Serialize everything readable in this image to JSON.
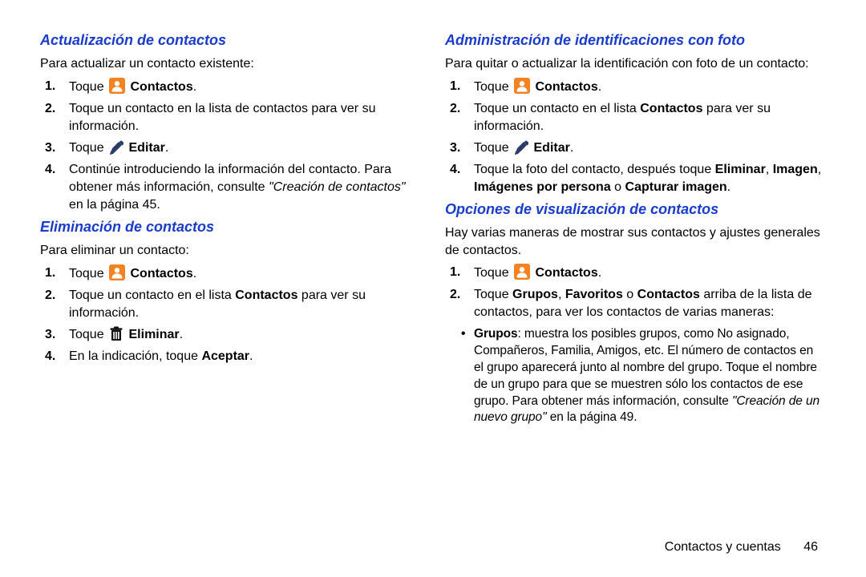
{
  "left": {
    "sec1": {
      "title": "Actualización de contactos",
      "intro": "Para actualizar un contacto existente:",
      "items": [
        {
          "pre": "Toque ",
          "icon": "contacts",
          "post": " ",
          "bold": "Contactos",
          "tail": "."
        },
        {
          "text": "Toque un contacto en la lista de contactos para ver su información."
        },
        {
          "pre": "Toque ",
          "icon": "pencil",
          "post": "  ",
          "bold": "Editar",
          "tail": "."
        },
        {
          "pre": "Continúe introduciendo la información del contacto. Para obtener más información, consulte ",
          "ital": "\"Creación de contactos\"",
          "tail": "  en la página 45."
        }
      ]
    },
    "sec2": {
      "title": "Eliminación de contactos",
      "intro": "Para eliminar un contacto:",
      "items": [
        {
          "pre": "Toque ",
          "icon": "contacts",
          "post": " ",
          "bold": "Contactos",
          "tail": "."
        },
        {
          "pre": "Toque un contacto en el lista ",
          "bold": "Contactos",
          "tail": " para ver su información."
        },
        {
          "pre": "Toque  ",
          "icon": "trash",
          "post": "  ",
          "bold": "Eliminar",
          "tail": "."
        },
        {
          "pre": "En la indicación, toque ",
          "bold": "Aceptar",
          "tail": "."
        }
      ]
    }
  },
  "right": {
    "sec1": {
      "title": "Administración de identificaciones con foto",
      "intro": "Para quitar o actualizar la identificación con foto de un contacto:",
      "items": [
        {
          "pre": "Toque ",
          "icon": "contacts",
          "post": " ",
          "bold": "Contactos",
          "tail": "."
        },
        {
          "pre": "Toque un contacto en el lista ",
          "bold": "Contactos",
          "tail": " para ver su información."
        },
        {
          "pre": "Toque ",
          "icon": "pencil",
          "post": "  ",
          "bold": "Editar",
          "tail": "."
        },
        {
          "multi": [
            {
              "t": "Toque la foto del contacto, después toque "
            },
            {
              "b": "Eliminar"
            },
            {
              "t": ", "
            },
            {
              "b": "Imagen"
            },
            {
              "t": ", "
            },
            {
              "b": "Imágenes por persona"
            },
            {
              "t": " o "
            },
            {
              "b": "Capturar imagen"
            },
            {
              "t": "."
            }
          ]
        }
      ]
    },
    "sec2": {
      "title": "Opciones de visualización de contactos",
      "intro": "Hay varias maneras de mostrar sus contactos y ajustes generales de contactos.",
      "items": [
        {
          "pre": "Toque ",
          "icon": "contacts",
          "post": " ",
          "bold": "Contactos",
          "tail": "."
        },
        {
          "multi": [
            {
              "t": "Toque "
            },
            {
              "b": "Grupos"
            },
            {
              "t": ", "
            },
            {
              "b": "Favoritos"
            },
            {
              "t": " o "
            },
            {
              "b": "Contactos"
            },
            {
              "t": " arriba de la lista de contactos, para ver los contactos de varias maneras:"
            }
          ]
        }
      ],
      "bullets": [
        {
          "lead": "Grupos",
          "rest": ": muestra los posibles grupos, como No asignado, Compañeros, Familia, Amigos, etc. El número de contactos en el grupo aparecerá junto al nombre del grupo. Toque el nombre de un grupo para que se muestren sólo los contactos de ese grupo. Para obtener más información, consulte ",
          "ital": "\"Creación de un nuevo grupo\"",
          "tail": "  en la página 49."
        }
      ]
    }
  },
  "footer": {
    "section": "Contactos y cuentas",
    "page": "46"
  }
}
